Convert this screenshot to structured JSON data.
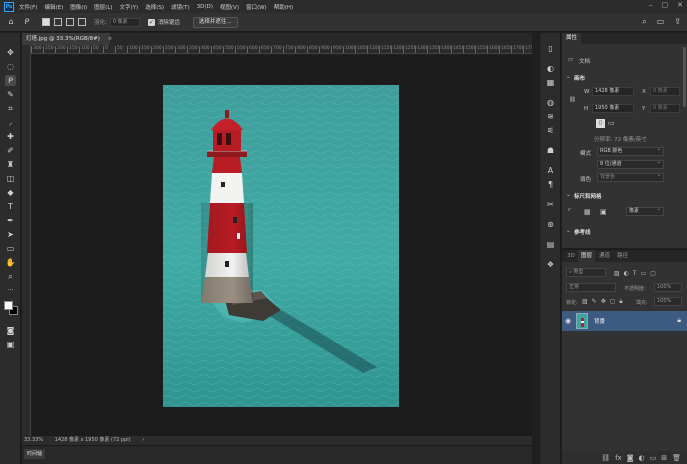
{
  "app": {
    "logo": "Ps"
  },
  "menu": [
    "文件(F)",
    "编辑(E)",
    "图像(I)",
    "图层(L)",
    "文字(Y)",
    "选择(S)",
    "滤镜(T)",
    "3D(D)",
    "视图(V)",
    "窗口(W)",
    "帮助(H)"
  ],
  "options_bar": {
    "feather_label": "羽化:",
    "feather_value": "0 像素",
    "antialias_label": "消除锯齿",
    "select_mask_button": "选择并遮住..."
  },
  "document": {
    "tab_title": "灯塔.jpg @ 33.3%(RGB/8#)",
    "close_glyph": "×"
  },
  "ruler_ticks": [
    "300",
    "250",
    "200",
    "150",
    "100",
    "50",
    "0",
    "50",
    "100",
    "150",
    "200",
    "250",
    "300",
    "350",
    "400",
    "450",
    "500",
    "550",
    "600",
    "650",
    "700",
    "750",
    "800",
    "850",
    "900",
    "950",
    "1000",
    "1050",
    "1100",
    "1150",
    "1200",
    "1250",
    "1300",
    "1350",
    "1400",
    "1450",
    "1500",
    "1550",
    "1600",
    "1650",
    "1700",
    "1750"
  ],
  "status_bar": {
    "zoom": "33.33%",
    "doc_info": "1428 像素 x 1950 像素 (72 ppi)",
    "arrow": "›"
  },
  "timeline_tab": "时间轴",
  "properties": {
    "tab_title": "属性",
    "doc_label": "文档",
    "canvas_section": "画布",
    "w_label": "W",
    "w_value": "1428 像素",
    "x_label": "X",
    "x_placeholder": "0 像素",
    "h_label": "H",
    "h_value": "1950 像素",
    "y_label": "Y",
    "y_placeholder": "0 像素",
    "resolution": "分辨率: 72 像素/英寸",
    "mode_label": "模式",
    "mode_value": "RGB 颜色",
    "depth_value": "8 位/通道",
    "fill_label": "填色",
    "fill_value": "背景色",
    "guides_section": "标尺和网格",
    "guides_units": "像素",
    "reference_section": "参考线"
  },
  "layers": {
    "tabs": [
      "3D",
      "图层",
      "通道",
      "路径"
    ],
    "active_tab_index": 1,
    "filter_kind": "类型",
    "blend_mode": "正常",
    "opacity_label": "不透明度:",
    "opacity_value": "100%",
    "lock_label": "锁定:",
    "fill_label": "填充:",
    "fill_value": "100%",
    "items": [
      {
        "name": "背景",
        "visible": true,
        "locked": true
      }
    ]
  }
}
